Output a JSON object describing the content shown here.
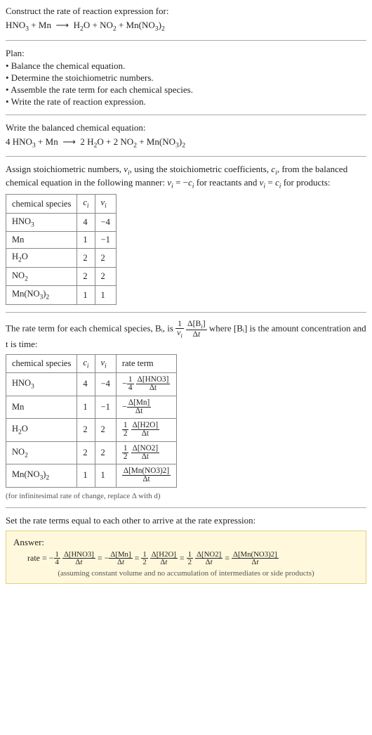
{
  "intro": {
    "title": "Construct the rate of reaction expression for:",
    "equation": "HNO₃ + Mn ⟶ H₂O + NO₂ + Mn(NO₃)₂"
  },
  "plan": {
    "title": "Plan:",
    "items": [
      "• Balance the chemical equation.",
      "• Determine the stoichiometric numbers.",
      "• Assemble the rate term for each chemical species.",
      "• Write the rate of reaction expression."
    ]
  },
  "balanced": {
    "title": "Write the balanced chemical equation:",
    "equation": "4 HNO₃ + Mn ⟶ 2 H₂O + 2 NO₂ + Mn(NO₃)₂"
  },
  "stoich": {
    "intro1": "Assign stoichiometric numbers, νᵢ, using the stoichiometric coefficients, cᵢ, from the balanced chemical equation in the following manner: νᵢ = −cᵢ for reactants and νᵢ = cᵢ for products:",
    "headers": [
      "chemical species",
      "cᵢ",
      "νᵢ"
    ],
    "rows": [
      {
        "sp": "HNO₃",
        "c": "4",
        "v": "−4"
      },
      {
        "sp": "Mn",
        "c": "1",
        "v": "−1"
      },
      {
        "sp": "H₂O",
        "c": "2",
        "v": "2"
      },
      {
        "sp": "NO₂",
        "c": "2",
        "v": "2"
      },
      {
        "sp": "Mn(NO₃)₂",
        "c": "1",
        "v": "1"
      }
    ]
  },
  "rate": {
    "intro_a": "The rate term for each chemical species, Bᵢ, is ",
    "intro_b": " where [Bᵢ] is the amount concentration and t is time:",
    "headers": [
      "chemical species",
      "cᵢ",
      "νᵢ",
      "rate term"
    ],
    "rows": [
      {
        "sp": "HNO₃",
        "c": "4",
        "v": "−4",
        "sign": "−",
        "coef_num": "1",
        "coef_den": "4",
        "num": "Δ[HNO3]",
        "den": "Δt"
      },
      {
        "sp": "Mn",
        "c": "1",
        "v": "−1",
        "sign": "−",
        "coef_num": "",
        "coef_den": "",
        "num": "Δ[Mn]",
        "den": "Δt"
      },
      {
        "sp": "H₂O",
        "c": "2",
        "v": "2",
        "sign": "",
        "coef_num": "1",
        "coef_den": "2",
        "num": "Δ[H2O]",
        "den": "Δt"
      },
      {
        "sp": "NO₂",
        "c": "2",
        "v": "2",
        "sign": "",
        "coef_num": "1",
        "coef_den": "2",
        "num": "Δ[NO2]",
        "den": "Δt"
      },
      {
        "sp": "Mn(NO₃)₂",
        "c": "1",
        "v": "1",
        "sign": "",
        "coef_num": "",
        "coef_den": "",
        "num": "Δ[Mn(NO3)2]",
        "den": "Δt"
      }
    ],
    "footnote": "(for infinitesimal rate of change, replace Δ with d)"
  },
  "final": {
    "title": "Set the rate terms equal to each other to arrive at the rate expression:",
    "answer_label": "Answer:",
    "note": "(assuming constant volume and no accumulation of intermediates or side products)"
  }
}
